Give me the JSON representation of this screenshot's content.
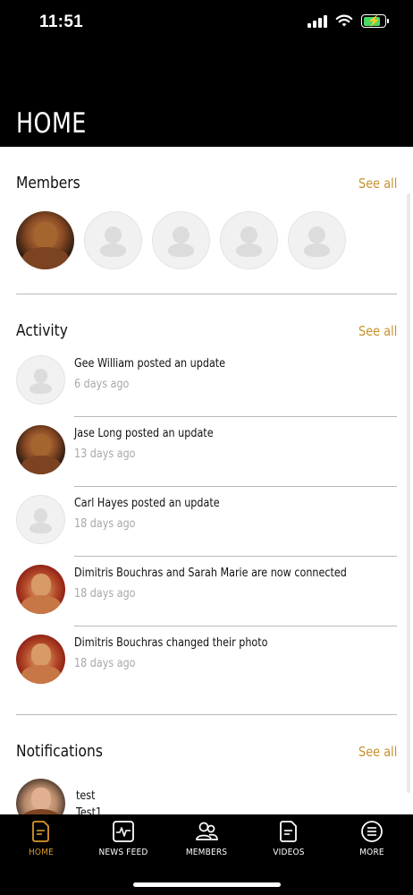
{
  "status_bar": {
    "time": "11:51"
  },
  "header": {
    "title": "HOME"
  },
  "members": {
    "title": "Members",
    "see_all": "See all"
  },
  "activity": {
    "title": "Activity",
    "see_all": "See all",
    "items": [
      {
        "text": "Gee William posted an update",
        "time": "6 days ago"
      },
      {
        "text": "Jase Long posted an update",
        "time": "13 days ago"
      },
      {
        "text": "Carl Hayes posted an update",
        "time": "18 days ago"
      },
      {
        "text": "Dimitris Bouchras and Sarah Marie are now connected",
        "time": "18 days ago"
      },
      {
        "text": "Dimitris Bouchras changed their photo",
        "time": "18 days ago"
      }
    ]
  },
  "notifications": {
    "title": "Notifications",
    "see_all": "See all",
    "items": [
      {
        "title": "test",
        "body": "Test1"
      }
    ]
  },
  "tabbar": {
    "items": [
      {
        "label": "HOME",
        "icon": "document-icon"
      },
      {
        "label": "NEWS FEED",
        "icon": "activity-icon"
      },
      {
        "label": "MEMBERS",
        "icon": "members-icon"
      },
      {
        "label": "VIDEOS",
        "icon": "document-icon"
      },
      {
        "label": "MORE",
        "icon": "menu-icon"
      }
    ]
  },
  "colors": {
    "accent": "#d99a2b",
    "header_bg": "#000000",
    "see_all": "#c8922a"
  }
}
